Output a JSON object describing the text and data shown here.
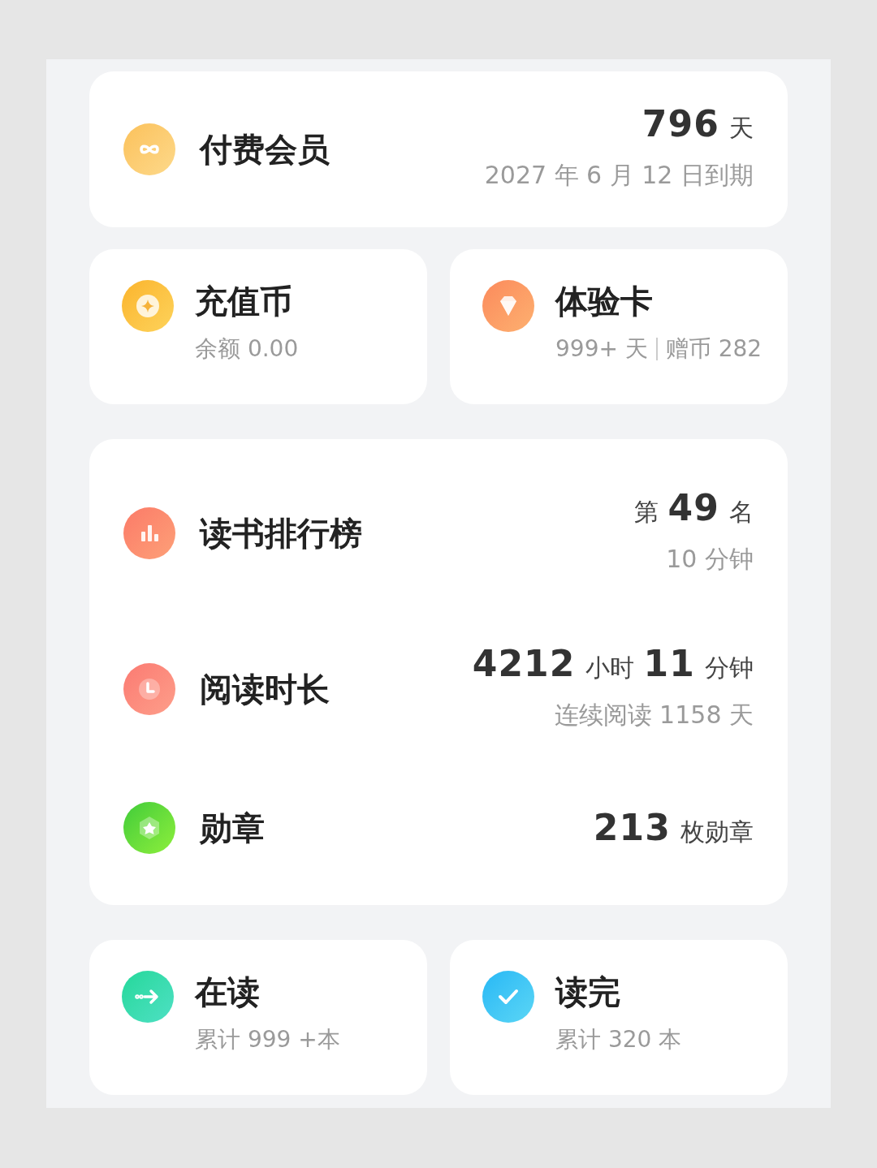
{
  "membership": {
    "title": "付费会员",
    "value": [
      {
        "kind": "number",
        "text": "796"
      },
      {
        "kind": "unit",
        "text": "天"
      }
    ],
    "note": "2027 年 6 月 12 日到期"
  },
  "wallet": [
    {
      "title": "充值币",
      "details": [
        "余额 0.00"
      ]
    },
    {
      "title": "体验卡",
      "details": [
        "999+ 天",
        "赠币 282"
      ]
    }
  ],
  "stats": [
    {
      "title": "读书排行榜",
      "value": [
        {
          "kind": "unit",
          "text": "第"
        },
        {
          "kind": "number",
          "text": "49"
        },
        {
          "kind": "unit",
          "text": "名"
        }
      ],
      "note": "10 分钟"
    },
    {
      "title": "阅读时长",
      "value": [
        {
          "kind": "number",
          "text": "4212"
        },
        {
          "kind": "unit",
          "text": "小时"
        },
        {
          "kind": "number",
          "text": "11"
        },
        {
          "kind": "unit",
          "text": "分钟"
        }
      ],
      "note": "连续阅读 1158 天"
    },
    {
      "title": "勋章",
      "value": [
        {
          "kind": "number",
          "text": "213"
        },
        {
          "kind": "unit",
          "text": "枚勋章"
        }
      ]
    }
  ],
  "shelf": [
    {
      "title": "在读",
      "details": [
        "累计 999 +本"
      ]
    },
    {
      "title": "读完",
      "details": [
        "累计 320 本"
      ]
    }
  ]
}
